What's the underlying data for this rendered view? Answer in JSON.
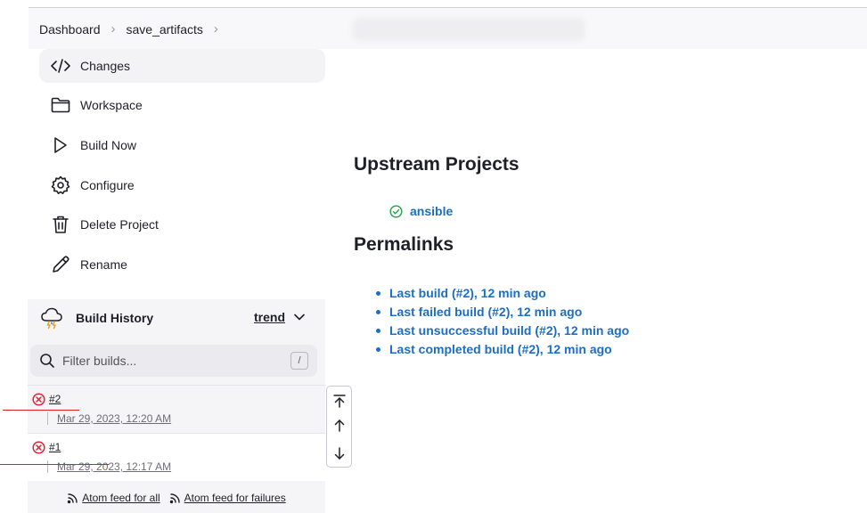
{
  "breadcrumb": {
    "items": [
      "Dashboard",
      "save_artifacts"
    ]
  },
  "tasks": [
    {
      "label": "Changes",
      "icon": "code-icon"
    },
    {
      "label": "Workspace",
      "icon": "folder-icon"
    },
    {
      "label": "Build Now",
      "icon": "play-icon"
    },
    {
      "label": "Configure",
      "icon": "gear-icon"
    },
    {
      "label": "Delete Project",
      "icon": "trash-icon"
    },
    {
      "label": "Rename",
      "icon": "pencil-icon"
    }
  ],
  "build_history": {
    "title": "Build History",
    "trend_label": "trend",
    "filter_placeholder": "Filter builds...",
    "filter_shortcut": "/",
    "builds": [
      {
        "number": "#2",
        "date": "Mar 29, 2023, 12:20 AM",
        "status": "failed"
      },
      {
        "number": "#1",
        "date": "Mar 29, 2023, 12:17 AM",
        "status": "failed"
      }
    ],
    "feed_all": "Atom feed for all",
    "feed_failures": "Atom feed for failures"
  },
  "upstream": {
    "title": "Upstream Projects",
    "items": [
      {
        "name": "ansible",
        "status": "success"
      }
    ]
  },
  "permalinks": {
    "title": "Permalinks",
    "items": [
      "Last build (#2), 12 min ago",
      "Last failed build (#2), 12 min ago",
      "Last unsuccessful build (#2), 12 min ago",
      "Last completed build (#2), 12 min ago"
    ]
  },
  "colors": {
    "link": "#1d6ec2",
    "failure": "#d9263b",
    "success": "#1ea446",
    "annotation": "#e02020"
  }
}
